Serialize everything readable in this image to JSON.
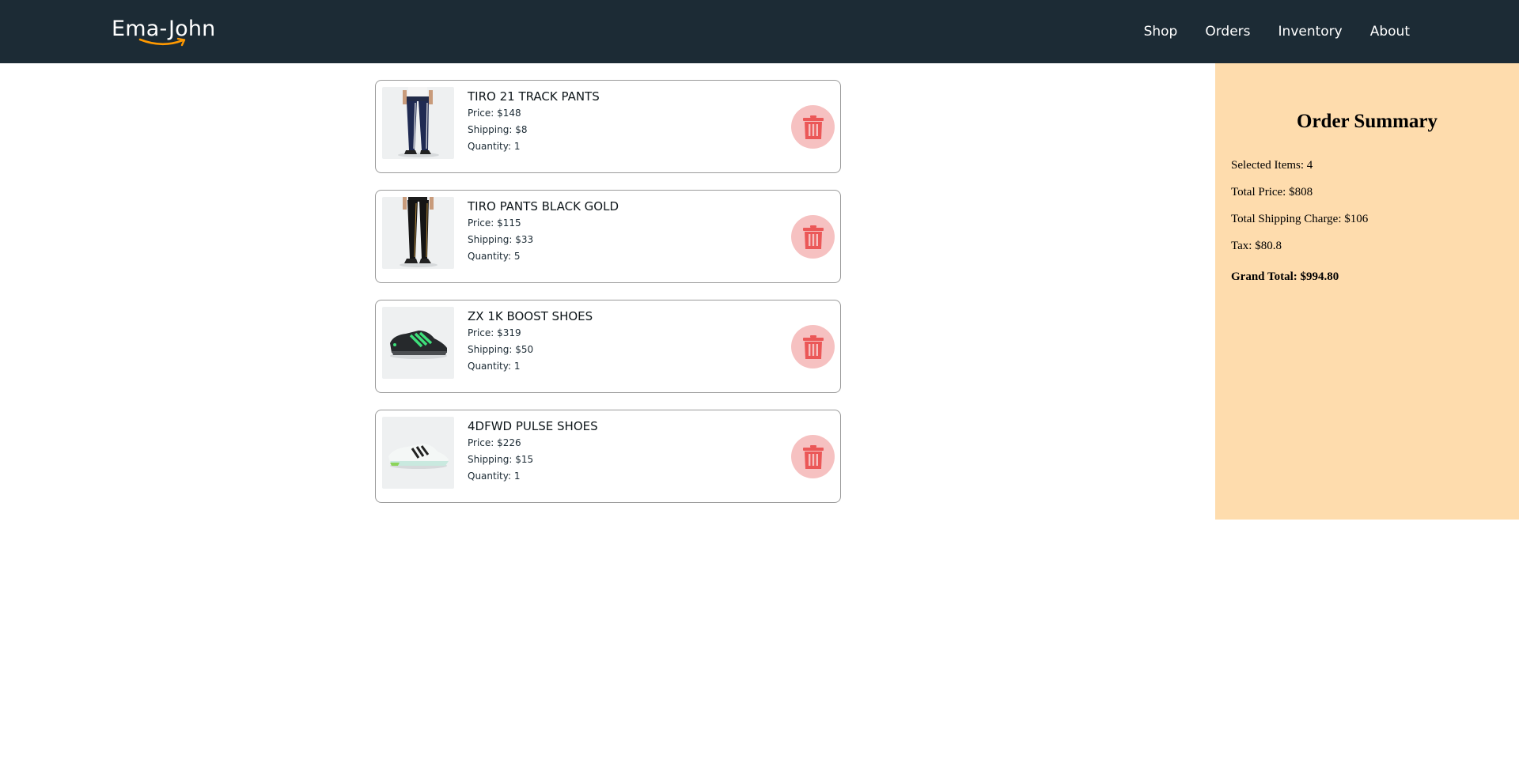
{
  "header": {
    "logo_text": "Ema-John",
    "nav": [
      {
        "label": "Shop"
      },
      {
        "label": "Orders"
      },
      {
        "label": "Inventory"
      },
      {
        "label": "About"
      }
    ]
  },
  "cart": {
    "items": [
      {
        "name": "TIRO 21 TRACK PANTS",
        "price": "Price: $148",
        "shipping": "Shipping: $8",
        "quantity": "Quantity: 1",
        "image_icon": "track-pants-navy"
      },
      {
        "name": "TIRO PANTS BLACK GOLD",
        "price": "Price: $115",
        "shipping": "Shipping: $33",
        "quantity": "Quantity: 5",
        "image_icon": "track-pants-black"
      },
      {
        "name": "ZX 1K BOOST SHOES",
        "price": "Price: $319",
        "shipping": "Shipping: $50",
        "quantity": "Quantity: 1",
        "image_icon": "sneaker-black-green"
      },
      {
        "name": "4DFWD PULSE SHOES",
        "price": "Price: $226",
        "shipping": "Shipping: $15",
        "quantity": "Quantity: 1",
        "image_icon": "sneaker-white-mint"
      }
    ],
    "delete_icon": "trash-icon"
  },
  "summary": {
    "title": "Order Summary",
    "selected_items": "Selected Items: 4",
    "total_price": "Total Price: $808",
    "total_shipping": "Total Shipping Charge: $106",
    "tax": "Tax: $80.8",
    "grand_total": "Grand Total: $994.80"
  },
  "colors": {
    "navbar": "#1c2b35",
    "summary_bg": "#fedcad",
    "delete_bg": "#f6c1c1",
    "delete_icon": "#eb5757",
    "accent_orange": "#ff9900"
  }
}
